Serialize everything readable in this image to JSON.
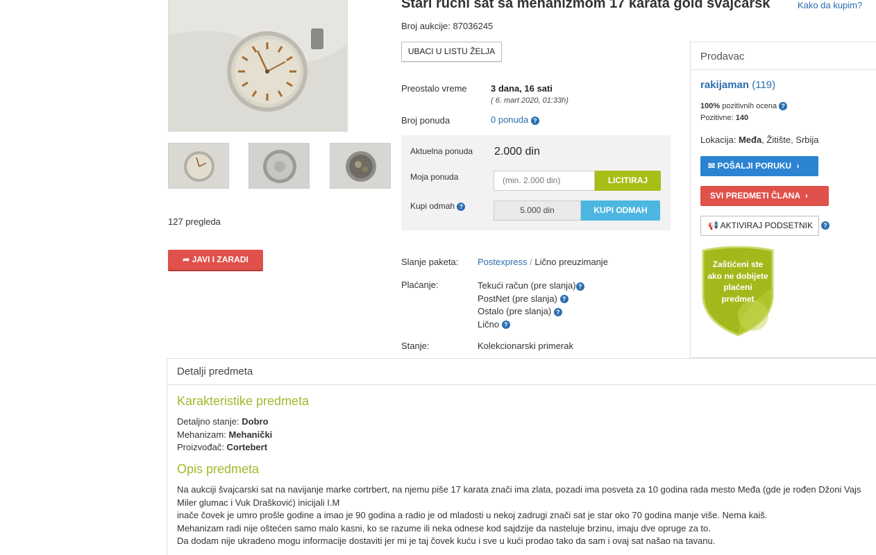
{
  "listing": {
    "title": "Stari ručni sat sa mehanizmom 17 karata gold švajcarsk",
    "how_to_buy": "Kako da kupim?",
    "auction_label": "Broj aukcije:",
    "auction_number": "87036245",
    "wishlist_btn": "UBACI U LISTU ŽELJA",
    "views": "127 pregleda",
    "share_btn": "JAVI I ZARADI"
  },
  "info": {
    "time_label": "Preostalo vreme",
    "time_value": "3 dana, 16 sati",
    "time_date": "( 6. mart 2020, 01:33h)",
    "bids_label": "Broj ponuda",
    "bids_value": "0 ponuda"
  },
  "bid": {
    "current_label": "Aktuelna ponuda",
    "current_value": "2.000 din",
    "my_label": "Moja ponuda",
    "my_placeholder": "(min. 2.000 din)",
    "bid_btn": "LICITIRAJ",
    "buy_label": "Kupi odmah",
    "buy_price": "5.000 din",
    "buy_btn": "KUPI ODMAH"
  },
  "shipping": {
    "label": "Slanje paketa:",
    "option1": "Postexpress",
    "sep": "/",
    "option2": "Lično preuzimanje"
  },
  "payment": {
    "label": "Plaćanje:",
    "methods": [
      "Tekući račun (pre slanja)",
      "PostNet (pre slanja)",
      "Ostalo (pre slanja)",
      "Lično"
    ]
  },
  "condition": {
    "label": "Stanje:",
    "value": "Kolekcionarski primerak"
  },
  "seller": {
    "heading": "Prodavac",
    "name": "rakijaman",
    "score": "(119)",
    "positive_pct": "100%",
    "positive_text": "pozitivnih ocena",
    "positive_label": "Pozitivne:",
    "positive_count": "140",
    "location_label": "Lokacija:",
    "location_city": "Međa",
    "location_rest": ", Žitište, Srbija",
    "message_btn": "POŠALJI PORUKU",
    "all_items_btn": "SVI PREDMETI ČLANA",
    "reminder_btn": "AKTIVIRAJ PODSETNIK",
    "badge_lines": [
      "Zaštićeni ste",
      "ako ne dobijete",
      "plaćeni",
      "predmet"
    ]
  },
  "details": {
    "heading": "Detalji predmeta",
    "char_heading": "Karakteristike predmeta",
    "chars": [
      {
        "label": "Detaljno stanje:",
        "value": "Dobro"
      },
      {
        "label": "Mehanizam:",
        "value": "Mehanički"
      },
      {
        "label": "Proizvođač:",
        "value": "Cortebert"
      }
    ],
    "desc_heading": "Opis predmeta",
    "desc_lines": [
      "Na aukciji švajcarski sat na navijanje marke cortrbert, na njemu piše 17 karata znači ima zlata, pozadi ima posveta za 10 godina rada mesto Međa (gde je rođen Džoni Vajs",
      "Miler glumac i Vuk Drašković) inicijali I.M",
      "inače čovek je umro prošle godine a imao je 90 godina a radio je od mladosti u nekoj zadrugi znači sat je star oko 70 godina manje više. Nema kaiš.",
      "Mehanizam radi nije oštećen samo malo kasni, ko se razume ili neka odnese kod sajdzije da nasteluje brzinu, imaju dve opruge za to.",
      "Da dodam nije ukradeno mogu informacije dostaviti jer mi je taj čovek kuću i sve u kući prodao tako da sam i ovaj sat našao na tavanu."
    ]
  },
  "colors": {
    "link": "#2b6eb0",
    "green": "#a7be17",
    "red": "#e0514b",
    "blue": "#4cb6e0"
  }
}
